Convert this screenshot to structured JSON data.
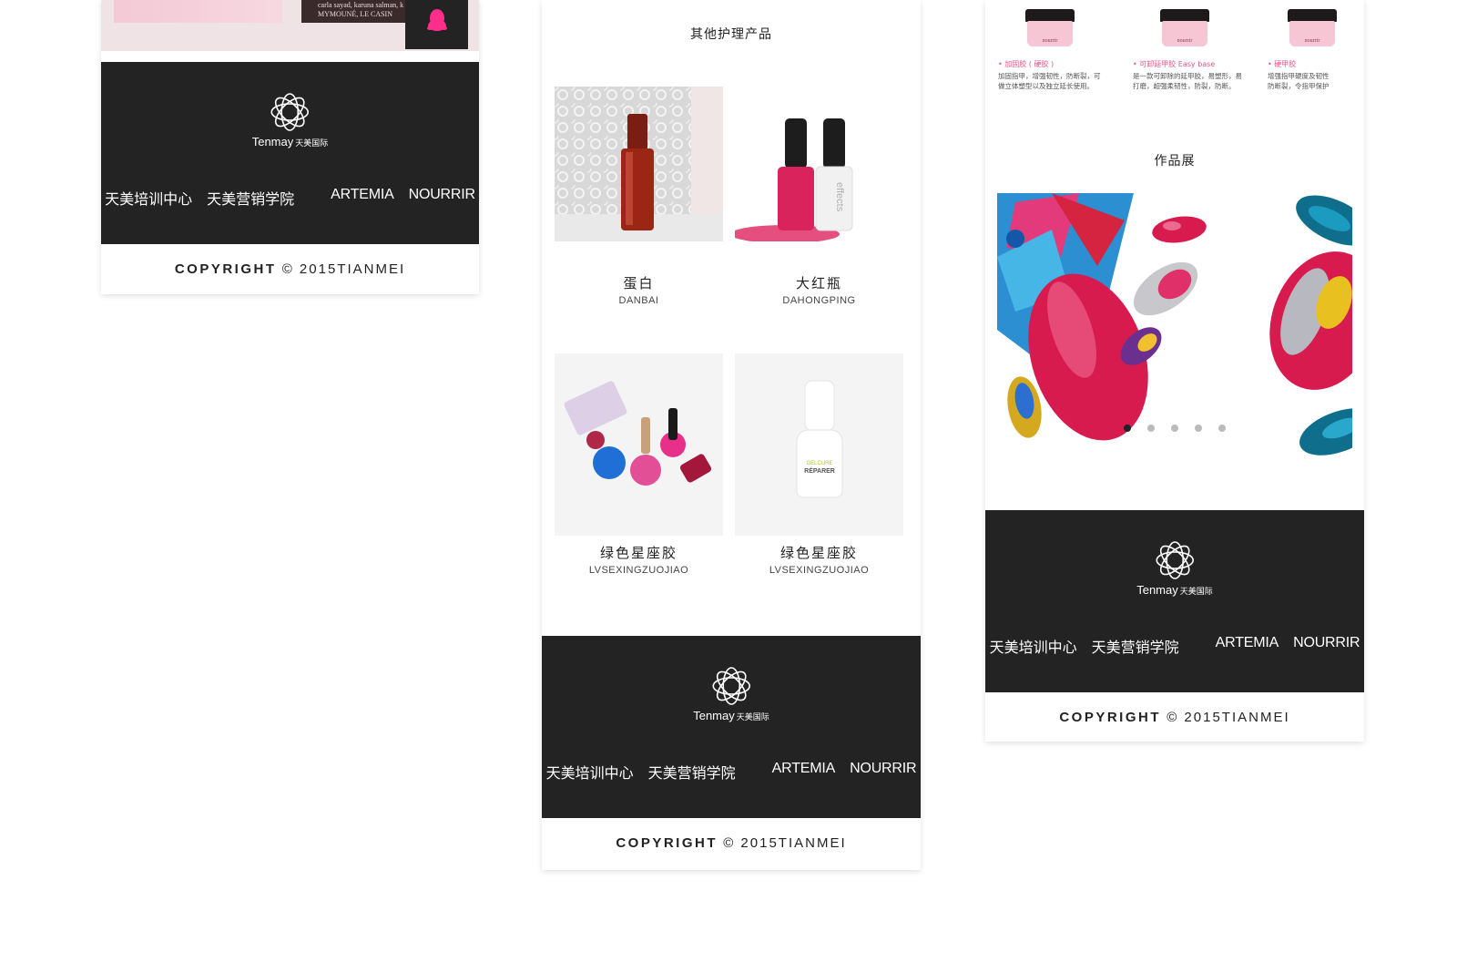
{
  "footer": {
    "logo_text": "Tenmay",
    "logo_cn": "天美国际",
    "links": [
      "天美培训中心",
      "天美营销学院",
      "ARTEMIA",
      "NOURRIR"
    ],
    "copyright_bold": "COPYRIGHT",
    "copyright_rest": "© 2015TIANMEI"
  },
  "left_panel": {
    "banner_caption_line1": "carla sayad, karuna salman, k",
    "banner_caption_line2": "MYMOUNÉ, LE CASIN",
    "qq_icon": "penguin-icon"
  },
  "mid_panel": {
    "section_title": "其他护理产品",
    "products": [
      {
        "name": "蛋白",
        "pinyin": "DANBAI"
      },
      {
        "name": "大红瓶",
        "pinyin": "DAHONGPING"
      },
      {
        "name": "绿色星座胶",
        "pinyin": "LVSEXINGZUOJIAO"
      },
      {
        "name": "绿色星座胶",
        "pinyin": "LVSEXINGZUOJIAO"
      }
    ],
    "bottle_labels": [
      "effects",
      "GELCURE",
      "RÉPARER"
    ]
  },
  "right_panel": {
    "jars": [
      {
        "brand": "nourrir",
        "caption": "• 加固胶 ( 硬胶 )",
        "desc": [
          "加固指甲，增强韧性，防断裂，可",
          "做立体塑型以及独立延长使用。"
        ]
      },
      {
        "brand": "nourrir",
        "caption": "• 可卸延甲胶 Easy base",
        "desc": [
          "是一款可卸除的延甲胶，易塑形，易",
          "打磨，超强柔韧性，防裂，防断。"
        ]
      },
      {
        "brand": "nourrir",
        "caption": "• 硬甲胶",
        "desc": [
          "增强指甲硬度及韧性",
          "防断裂，令指甲保护"
        ]
      }
    ],
    "section_title": "作品展",
    "carousel": {
      "total": 5,
      "active_index": 0
    }
  },
  "colors": {
    "footer_bg": "#232323",
    "accent_pink": "#e0306a"
  }
}
